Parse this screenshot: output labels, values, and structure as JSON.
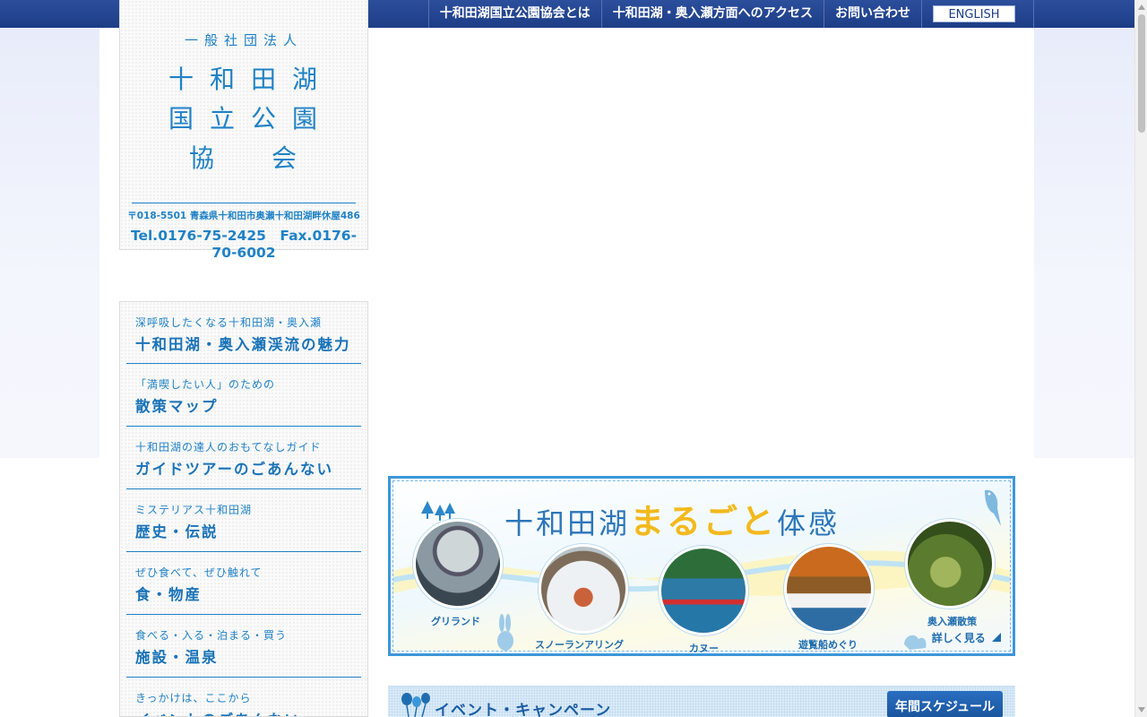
{
  "top_nav": {
    "items": [
      {
        "label": "十和田湖国立公園協会とは"
      },
      {
        "label": "十和田湖・奥入瀬方面へのアクセス"
      },
      {
        "label": "お問い合わせ"
      }
    ],
    "english_label": "ENGLISH"
  },
  "logo": {
    "org_type": "一般社団法人",
    "line1": "十和田湖",
    "line2": "国立公園",
    "line3": "協　会",
    "address": "〒018-5501 青森県十和田市奥瀬十和田湖畔休屋486",
    "contact": "Tel.0176-75-2425　Fax.0176-70-6002"
  },
  "side_menu": {
    "items": [
      {
        "sub": "深呼吸したくなる十和田湖・奥入瀬",
        "main": "十和田湖・奥入瀬渓流の魅力"
      },
      {
        "sub": "「満喫したい人」のための",
        "main": "散策マップ"
      },
      {
        "sub": "十和田湖の達人のおもてなしガイド",
        "main": "ガイドツアーのごあんない"
      },
      {
        "sub": "ミステリアス十和田湖",
        "main": "歴史・伝説"
      },
      {
        "sub": "ぜひ食べて、ぜひ触れて",
        "main": "食・物産"
      },
      {
        "sub": "食べる・入る・泊まる・買う",
        "main": "施設・温泉"
      },
      {
        "sub": "きっかけは、ここから",
        "main": "イベントのごあんない"
      }
    ]
  },
  "banner": {
    "title_prefix": "十和田湖",
    "title_highlight": "まるごと",
    "title_suffix": "体感",
    "activities": [
      {
        "label": "グリランド"
      },
      {
        "label": "スノーランアリング"
      },
      {
        "label": "カヌー"
      },
      {
        "label": "遊覧船めぐり"
      },
      {
        "label": "奥入瀬散策"
      }
    ],
    "more_label": "詳しく見る"
  },
  "events": {
    "title": "イベント・キャンペーン",
    "schedule_label": "年間スケジュール"
  },
  "colors": {
    "nav_blue": "#1d3d86",
    "accent_blue": "#1f82c6",
    "highlight_yellow": "#f3b91d"
  }
}
